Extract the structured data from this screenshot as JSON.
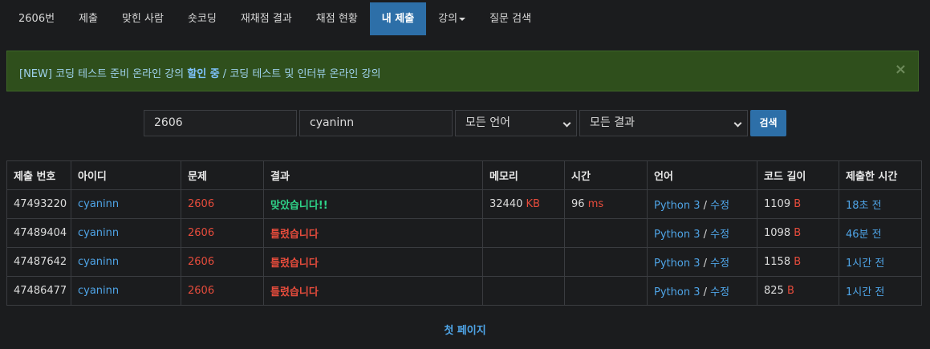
{
  "nav": {
    "items": [
      "2606번",
      "제출",
      "맞힌 사람",
      "숏코딩",
      "재채점 결과",
      "채점 현황",
      "내 제출",
      "강의",
      "질문 검색"
    ],
    "active_index": 6
  },
  "alert": {
    "prefix": "[NEW] 코딩 테스트 준비 온라인 강의 ",
    "highlight": "할인 중",
    "suffix": " / 코딩 테스트 및 인터뷰 온라인 강의",
    "close": "×"
  },
  "search": {
    "problem_id": "2606",
    "user_id": "cyaninn",
    "language": "모든 언어",
    "result": "모든 결과",
    "button": "검색"
  },
  "table": {
    "headers": [
      "제출 번호",
      "아이디",
      "문제",
      "결과",
      "메모리",
      "시간",
      "언어",
      "코드 길이",
      "제출한 시간"
    ],
    "rows": [
      {
        "id": "47493220",
        "user": "cyaninn",
        "problem": "2606",
        "result": "맞았습니다!!",
        "accepted": true,
        "memory": "32440",
        "memory_unit": "KB",
        "time": "96",
        "time_unit": "ms",
        "language": "Python 3",
        "edit": "수정",
        "code_length": "1109",
        "code_unit": "B",
        "submitted": "18초 전"
      },
      {
        "id": "47489404",
        "user": "cyaninn",
        "problem": "2606",
        "result": "틀렸습니다",
        "accepted": false,
        "memory": "",
        "memory_unit": "",
        "time": "",
        "time_unit": "",
        "language": "Python 3",
        "edit": "수정",
        "code_length": "1098",
        "code_unit": "B",
        "submitted": "46분 전"
      },
      {
        "id": "47487642",
        "user": "cyaninn",
        "problem": "2606",
        "result": "틀렸습니다",
        "accepted": false,
        "memory": "",
        "memory_unit": "",
        "time": "",
        "time_unit": "",
        "language": "Python 3",
        "edit": "수정",
        "code_length": "1158",
        "code_unit": "B",
        "submitted": "1시간 전"
      },
      {
        "id": "47486477",
        "user": "cyaninn",
        "problem": "2606",
        "result": "틀렸습니다",
        "accepted": false,
        "memory": "",
        "memory_unit": "",
        "time": "",
        "time_unit": "",
        "language": "Python 3",
        "edit": "수정",
        "code_length": "825",
        "code_unit": "B",
        "submitted": "1시간 전"
      }
    ]
  },
  "pager": {
    "first_page": "첫 페이지"
  },
  "colors": {
    "accent": "#2d6fa8",
    "link": "#4fa5e8",
    "accepted": "#2fd58a",
    "wrong": "#e74c3c",
    "alert_bg": "#2f4f1c"
  }
}
